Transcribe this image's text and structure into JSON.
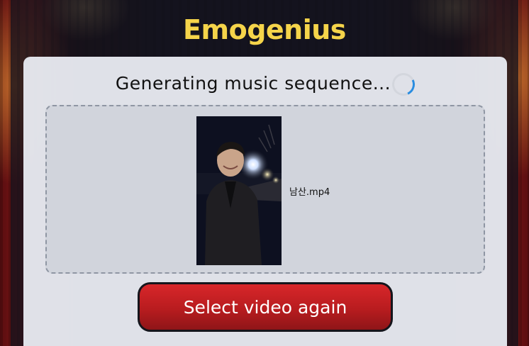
{
  "app": {
    "title": "Emogenius"
  },
  "status": {
    "text": "Generating music sequence...",
    "spinner_icon": "loading-spinner-icon",
    "spinner_color": "#2a8de0"
  },
  "upload": {
    "file_name": "남산.mp4",
    "thumbnail": "video-thumbnail-person-night"
  },
  "actions": {
    "select_again_label": "Select video again",
    "button_color": "#c0201f"
  },
  "theme": {
    "title_color": "#f5d44a",
    "card_color": "#e8eaf0"
  }
}
